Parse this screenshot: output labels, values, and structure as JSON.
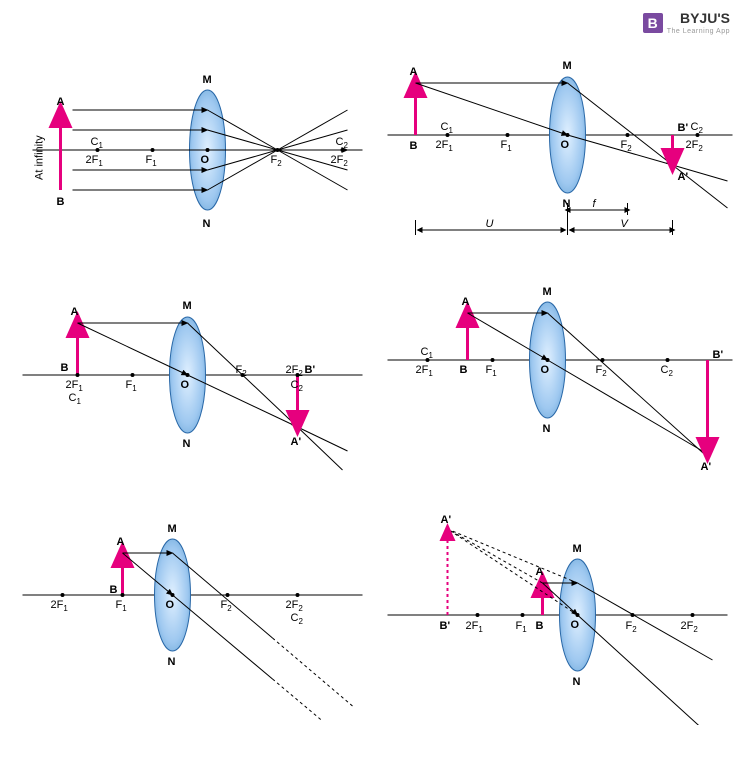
{
  "brand": {
    "mark": "B",
    "name": "BYJU'S",
    "tagline": "The Learning App"
  },
  "labels": {
    "A": "A",
    "B": "B",
    "Ap": "A'",
    "Bp": "B'",
    "M": "M",
    "N": "N",
    "O": "O",
    "F1": "F",
    "F1sub": "1",
    "F2": "F",
    "F2sub": "2",
    "C1": "C",
    "C1sub": "1",
    "C2": "C",
    "C2sub": "2",
    "twoF1": "2F",
    "twoF1sub": "1",
    "twoF2": "2F",
    "twoF2sub": "2",
    "atInfinity": "At infinity",
    "U": "U",
    "V": "V",
    "f": "f"
  },
  "diagram_data": {
    "type": "ray-diagram-set",
    "lens": "convex",
    "cases": [
      {
        "id": 1,
        "object_position": "infinity",
        "image_position": "at F2",
        "image_nature": "real, inverted, point-sized"
      },
      {
        "id": 2,
        "object_position": "beyond 2F1",
        "image_position": "between F2 and 2F2",
        "image_nature": "real, inverted, diminished"
      },
      {
        "id": 3,
        "object_position": "at 2F1",
        "image_position": "at 2F2",
        "image_nature": "real, inverted, same size"
      },
      {
        "id": 4,
        "object_position": "between F1 and 2F1",
        "image_position": "beyond 2F2",
        "image_nature": "real, inverted, enlarged"
      },
      {
        "id": 5,
        "object_position": "at F1",
        "image_position": "infinity",
        "image_nature": "real, inverted, highly enlarged"
      },
      {
        "id": 6,
        "object_position": "between F1 and O",
        "image_position": "same side as object",
        "image_nature": "virtual, erect, enlarged"
      }
    ]
  }
}
